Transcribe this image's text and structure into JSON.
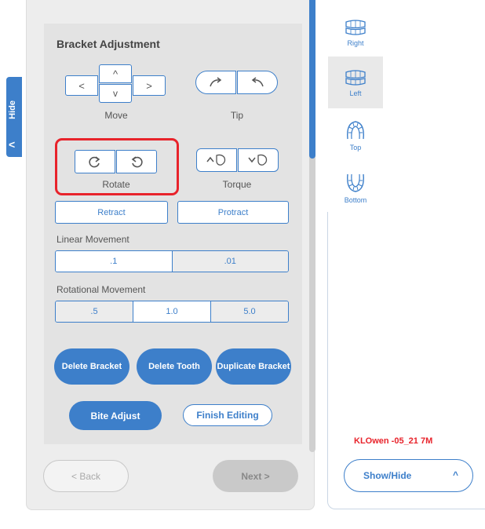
{
  "hide_tab": {
    "label": "Hide",
    "chevron": "<"
  },
  "bracket_adjustment": {
    "title": "Bracket Adjustment",
    "move": {
      "label": "Move",
      "left": "<",
      "up": "^",
      "down": "v",
      "right": ">"
    },
    "tip": {
      "label": "Tip"
    },
    "rotate": {
      "label": "Rotate"
    },
    "torque": {
      "label": "Torque"
    },
    "retract_label": "Retract",
    "protract_label": "Protract",
    "linear_movement": {
      "label": "Linear Movement",
      "options": [
        ".1",
        ".01"
      ],
      "selected": ".1"
    },
    "rotational_movement": {
      "label": "Rotational Movement",
      "options": [
        ".5",
        "1.0",
        "5.0"
      ],
      "selected": "1.0"
    },
    "delete_bracket": "Delete Bracket",
    "delete_tooth": "Delete Tooth",
    "duplicate_bracket": "Duplicate Bracket",
    "bite_adjust": "Bite Adjust",
    "finish_editing": "Finish Editing"
  },
  "nav": {
    "back": "< Back",
    "next": "Next >"
  },
  "views": [
    {
      "label": "Right",
      "icon": "teeth-right-icon",
      "active": false
    },
    {
      "label": "Left",
      "icon": "teeth-left-icon",
      "active": true
    },
    {
      "label": "Top",
      "icon": "teeth-top-icon",
      "active": false
    },
    {
      "label": "Bottom",
      "icon": "teeth-bottom-icon",
      "active": false
    }
  ],
  "patient_label": "KLOwen -05_21 7M",
  "show_hide": {
    "label": "Show/Hide",
    "caret": "^"
  },
  "colors": {
    "accent": "#3d7fca",
    "highlight": "#e8232b",
    "panel": "#e3e3e3"
  }
}
